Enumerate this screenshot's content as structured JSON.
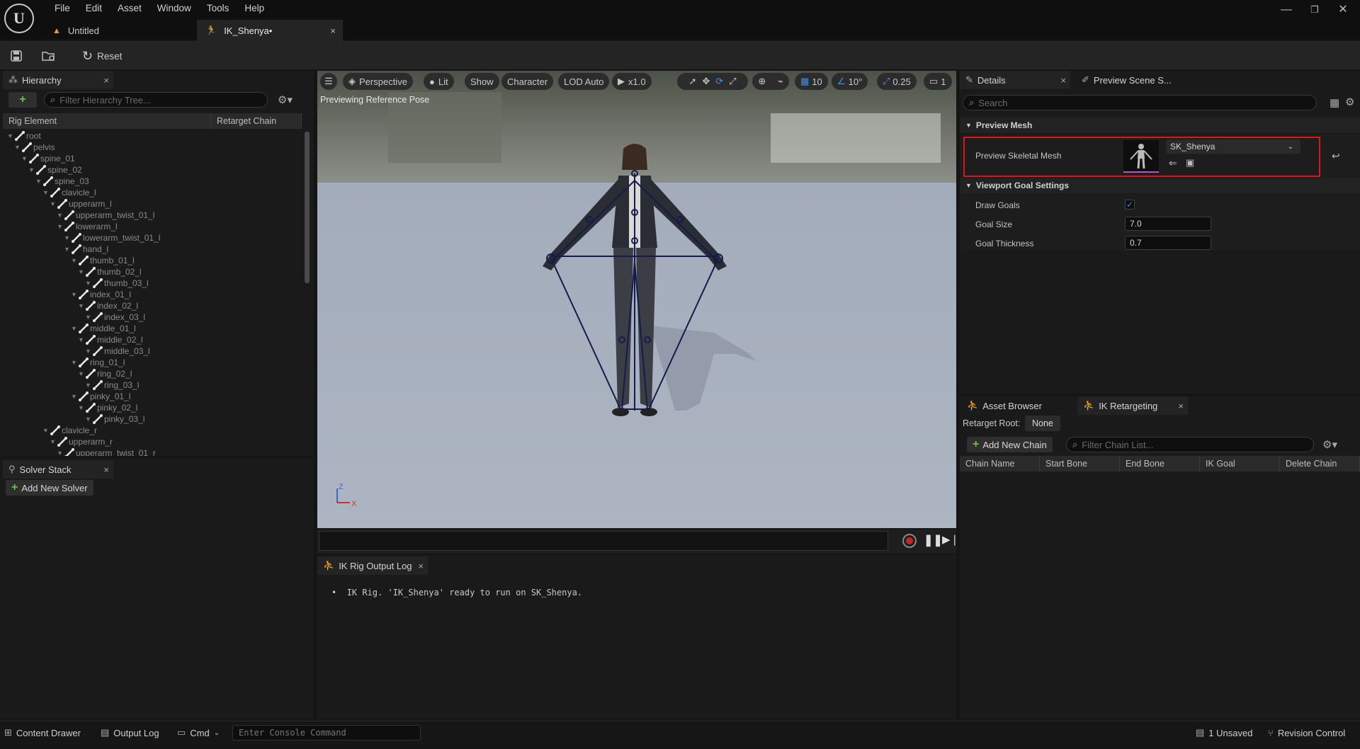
{
  "menu": [
    "File",
    "Edit",
    "Asset",
    "Window",
    "Tools",
    "Help"
  ],
  "doc_tabs": [
    {
      "label": "Untitled"
    },
    {
      "label": "IK_Shenya•",
      "close": "×"
    }
  ],
  "toolbar": {
    "reset_label": "Reset"
  },
  "hierarchy": {
    "tab_label": "Hierarchy",
    "close": "×",
    "add": "+",
    "search_placeholder": "Filter Hierarchy Tree...",
    "col_rig_element": "Rig Element",
    "col_retarget_chain": "Retarget Chain",
    "rows": [
      {
        "label": "root",
        "depth": 0
      },
      {
        "label": "pelvis",
        "depth": 1
      },
      {
        "label": "spine_01",
        "depth": 2
      },
      {
        "label": "spine_02",
        "depth": 3
      },
      {
        "label": "spine_03",
        "depth": 4
      },
      {
        "label": "clavicle_l",
        "depth": 5
      },
      {
        "label": "upperarm_l",
        "depth": 6
      },
      {
        "label": "upperarm_twist_01_l",
        "depth": 7
      },
      {
        "label": "lowerarm_l",
        "depth": 7
      },
      {
        "label": "lowerarm_twist_01_l",
        "depth": 8
      },
      {
        "label": "hand_l",
        "depth": 8
      },
      {
        "label": "thumb_01_l",
        "depth": 9
      },
      {
        "label": "thumb_02_l",
        "depth": 10
      },
      {
        "label": "thumb_03_l",
        "depth": 11
      },
      {
        "label": "index_01_l",
        "depth": 9
      },
      {
        "label": "index_02_l",
        "depth": 10
      },
      {
        "label": "index_03_l",
        "depth": 11
      },
      {
        "label": "middle_01_l",
        "depth": 9
      },
      {
        "label": "middle_02_l",
        "depth": 10
      },
      {
        "label": "middle_03_l",
        "depth": 11
      },
      {
        "label": "ring_01_l",
        "depth": 9
      },
      {
        "label": "ring_02_l",
        "depth": 10
      },
      {
        "label": "ring_03_l",
        "depth": 11
      },
      {
        "label": "pinky_01_l",
        "depth": 9
      },
      {
        "label": "pinky_02_l",
        "depth": 10
      },
      {
        "label": "pinky_03_l",
        "depth": 11
      },
      {
        "label": "clavicle_r",
        "depth": 5
      },
      {
        "label": "upperarm_r",
        "depth": 6
      },
      {
        "label": "upperarm_twist_01_r",
        "depth": 7
      }
    ]
  },
  "solver": {
    "tab_label": "Solver Stack",
    "close": "×",
    "add_label": "Add New Solver"
  },
  "viewport": {
    "perspective": "Perspective",
    "lit": "Lit",
    "show": "Show",
    "character": "Character",
    "lod": "LOD Auto",
    "speed": "x1.0",
    "grid": "10",
    "angle": "10°",
    "scale": "0.25",
    "camera": "1",
    "preview_text": "Previewing Reference Pose",
    "axis_z": "Z",
    "axis_x": "X"
  },
  "output_log": {
    "tab_label": "IK Rig Output Log",
    "close": "×",
    "message": "IK Rig. 'IK_Shenya' ready to run on SK_Shenya."
  },
  "details": {
    "tab_label": "Details",
    "close": "×",
    "tab2_label": "Preview Scene S...",
    "search_placeholder": "Search",
    "section_preview": "Preview Mesh",
    "preview_mesh_label": "Preview Skeletal Mesh",
    "preview_mesh_value": "SK_Shenya",
    "section_goal": "Viewport Goal Settings",
    "draw_goals_label": "Draw Goals",
    "draw_goals_checked": true,
    "goal_size_label": "Goal Size",
    "goal_size_value": "7.0",
    "goal_thickness_label": "Goal Thickness",
    "goal_thickness_value": "0.7"
  },
  "retarget": {
    "tab_asset_browser": "Asset Browser",
    "tab_ik_retargeting": "IK Retargeting",
    "close": "×",
    "root_label": "Retarget Root:",
    "root_value": "None",
    "add_chain_label": "Add New Chain",
    "filter_placeholder": "Filter Chain List...",
    "columns": [
      "Chain Name",
      "Start Bone",
      "End Bone",
      "IK Goal",
      "Delete Chain"
    ]
  },
  "statusbar": {
    "content_drawer": "Content Drawer",
    "output_log": "Output Log",
    "cmd": "Cmd",
    "console_placeholder": "Enter Console Command",
    "unsaved": "1 Unsaved",
    "revision": "Revision Control"
  },
  "colors": {
    "accent": "#0070e0",
    "highlight": "#e0141e",
    "add_green": "#6cc04a",
    "viewport_floor": "#a9b2c1"
  }
}
